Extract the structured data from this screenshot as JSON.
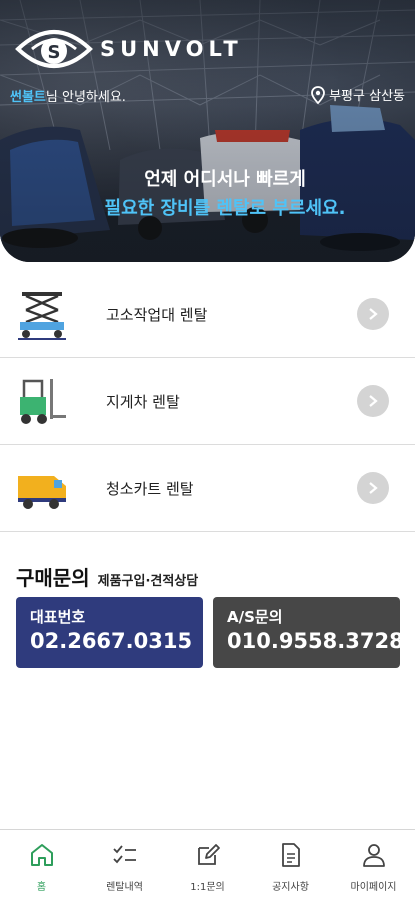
{
  "header": {
    "logo_text": "SUNVOLT",
    "logo_letter": "S",
    "greeting_name": "썬볼트",
    "greeting_suffix": "님 안녕하세요.",
    "location": "부평구 삼산동",
    "slogan_line1": "언제 어디서나 빠르게",
    "slogan_line2": "필요한 장비를 렌탈로 부르세요."
  },
  "menu": {
    "items": [
      {
        "label": "고소작업대 렌탈",
        "icon": "scissor-lift-icon"
      },
      {
        "label": "지게차 렌탈",
        "icon": "forklift-icon"
      },
      {
        "label": "청소카트 렌탈",
        "icon": "cleaning-cart-icon"
      }
    ]
  },
  "purchase": {
    "title": "구매문의",
    "subtitle": "제품구입·견적상담",
    "main_phone": {
      "label": "대표번호",
      "number": "02.2667.0315"
    },
    "as_phone": {
      "label": "A/S문의",
      "number": "010.9558.3728"
    }
  },
  "tabbar": {
    "active": "home",
    "items": [
      {
        "label": "홈",
        "icon": "home-icon"
      },
      {
        "label": "렌탈내역",
        "icon": "checklist-icon"
      },
      {
        "label": "1:1문의",
        "icon": "edit-icon"
      },
      {
        "label": "공지사항",
        "icon": "document-icon"
      },
      {
        "label": "마이페이지",
        "icon": "user-icon"
      }
    ]
  },
  "colors": {
    "accent_blue": "#4fc3f7",
    "main_phone_bg": "#2f3b7d",
    "as_phone_bg": "#474747",
    "active_tab": "#2e9e5b"
  }
}
